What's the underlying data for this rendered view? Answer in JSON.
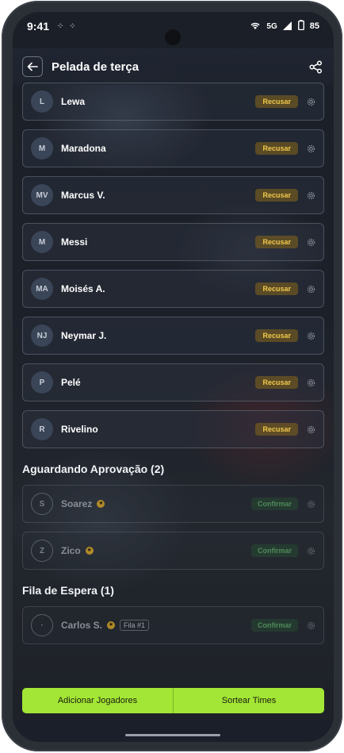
{
  "status_bar": {
    "time": "9:41",
    "network": "5G",
    "battery": "85"
  },
  "app_bar": {
    "title": "Pelada de terça"
  },
  "confirmed_players": [
    {
      "initials": "L",
      "name": "Lewa",
      "action": "Recusar"
    },
    {
      "initials": "M",
      "name": "Maradona",
      "action": "Recusar"
    },
    {
      "initials": "MV",
      "name": "Marcus V.",
      "action": "Recusar"
    },
    {
      "initials": "M",
      "name": "Messi",
      "action": "Recusar"
    },
    {
      "initials": "MA",
      "name": "Moisés A.",
      "action": "Recusar"
    },
    {
      "initials": "NJ",
      "name": "Neymar J.",
      "action": "Recusar"
    },
    {
      "initials": "P",
      "name": "Pelé",
      "action": "Recusar"
    },
    {
      "initials": "R",
      "name": "Rivelino",
      "action": "Recusar"
    }
  ],
  "pending_section": {
    "title": "Aguardando Aprovação (2)"
  },
  "pending_players": [
    {
      "initials": "S",
      "name": "Soarez",
      "action": "Confirmar"
    },
    {
      "initials": "Z",
      "name": "Zico",
      "action": "Confirmar"
    }
  ],
  "waitlist_section": {
    "title": "Fila de Espera (1)"
  },
  "waitlist_players": [
    {
      "initials": "·",
      "name": "Carlos S.",
      "tag": "Fila #1",
      "action": "Confirmar"
    }
  ],
  "footer": {
    "add_label": "Adicionar Jogadores",
    "draw_label": "Sortear Times"
  },
  "colors": {
    "accent": "#a3e635",
    "refuse": "#f2c94c",
    "confirm": "#4e8a5a"
  }
}
